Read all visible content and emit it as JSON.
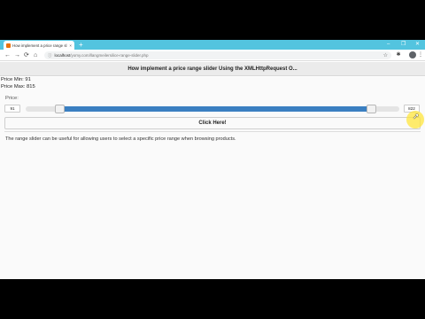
{
  "browser": {
    "tab_title": "How implement a price range sl",
    "tab_close": "×",
    "new_tab": "+",
    "url_host": "localhost",
    "url_path": "/yomy.com/llangmeilersilice-range-slider.php",
    "win_minimize": "–",
    "win_restore": "❐",
    "win_close": "✕",
    "back": "←",
    "forward": "→",
    "reload": "⟳",
    "home": "⌂",
    "lock": "ⓘ",
    "star": "☆",
    "extensions": "✱",
    "menu": "⋮",
    "accent": "#53c4df"
  },
  "header": {
    "title": "How implement a price range slider Using the XMLHttpRequest O..."
  },
  "price_info": {
    "min_text": "Price Min: 91",
    "max_text": "Price Max: 815"
  },
  "slider": {
    "label": "Price:",
    "min_input": "91",
    "max_input": "822",
    "min_fraction": 0.09,
    "max_fraction": 0.925,
    "fill_color": "#3a7fc1"
  },
  "button": {
    "label": "Click Here!"
  },
  "description": "The range slider can be useful for allowing users to select a specific price range when browsing products."
}
